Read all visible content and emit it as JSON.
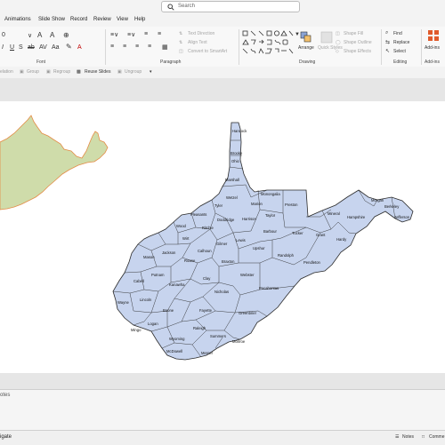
{
  "search": {
    "placeholder": "Search"
  },
  "tabs": [
    "Animations",
    "Slide Show",
    "Record",
    "Review",
    "View",
    "Help"
  ],
  "ribbon": {
    "groups": {
      "font": "Font",
      "paragraph": "Paragraph",
      "drawing": "Drawing",
      "editing": "Editing",
      "addins": "Add-ins"
    },
    "paragraph": {
      "text_direction": "Text Direction",
      "align_text": "Align Text",
      "convert_smartart": "Convert to SmartArt"
    },
    "drawing": {
      "arrange": "Arrange",
      "quick_styles": "Quick Styles",
      "shape_fill": "Shape Fill",
      "shape_outline": "Shape Outline",
      "shape_effects": "Shape Effects"
    },
    "editing": {
      "find": "Find",
      "replace": "Replace",
      "select": "Select"
    },
    "addins": {
      "label": "Add-ins"
    }
  },
  "qat": {
    "items": [
      "elation",
      "Group",
      "Regroup",
      "Reuse Slides",
      "Ungroup"
    ]
  },
  "map": {
    "counties": [
      "Hancock",
      "Brooke",
      "Ohio",
      "Marshall",
      "Monongalia",
      "Wetzel",
      "Marion",
      "Preston",
      "Tyler",
      "Pleasants",
      "Doddridge",
      "Harrison",
      "Taylor",
      "Morgan",
      "Berkeley",
      "Jefferson",
      "Mineral",
      "Hampshire",
      "Wood",
      "Ritchie",
      "Barbour",
      "Tucker",
      "Grant",
      "Hardy",
      "Wirt",
      "Gilmer",
      "Lewis",
      "Upshur",
      "Jackson",
      "Mason",
      "Roane",
      "Calhoun",
      "Braxton",
      "Randolph",
      "Pendleton",
      "Putnam",
      "Clay",
      "Webster",
      "Cabell",
      "Kanawha",
      "Nicholas",
      "Pocahontas",
      "Wayne",
      "Lincoln",
      "Boone",
      "Fayette",
      "Greenbrier",
      "Logan",
      "Mingo",
      "Raleigh",
      "Wyoming",
      "Summers",
      "Monroe",
      "McDowell",
      "Mercer"
    ],
    "colors": {
      "fill": "#c7d4ee",
      "stroke": "#2b2b2b",
      "neighbor_fill": "#cfdcaa",
      "neighbor_stroke": "#e48c46"
    }
  },
  "notes": {
    "label": "otes"
  },
  "status": {
    "left": "igate",
    "notes": "Notes",
    "comments": "Comme"
  }
}
